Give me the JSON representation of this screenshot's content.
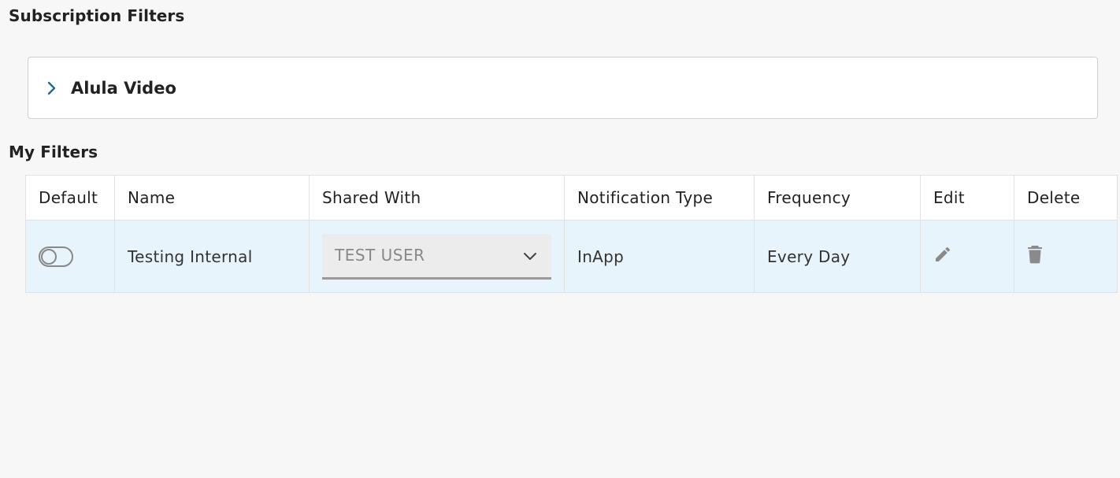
{
  "sections": {
    "subscription_title": "Subscription Filters",
    "my_filters_title": "My Filters"
  },
  "accordion": {
    "label": "Alula Video",
    "icon": "chevron-right-icon",
    "icon_color": "#1f6e8c"
  },
  "table": {
    "headers": {
      "default": "Default",
      "name": "Name",
      "shared_with": "Shared With",
      "notification_type": "Notification Type",
      "frequency": "Frequency",
      "edit": "Edit",
      "delete": "Delete"
    },
    "rows": [
      {
        "default_on": false,
        "name": "Testing Internal",
        "shared_with": "TEST USER",
        "notification_type": "InApp",
        "frequency": "Every Day",
        "edit_icon": "pencil-icon",
        "delete_icon": "trash-icon"
      }
    ]
  },
  "colors": {
    "row_highlight": "#e8f4fc",
    "icon_gray": "#8a8a8a"
  }
}
